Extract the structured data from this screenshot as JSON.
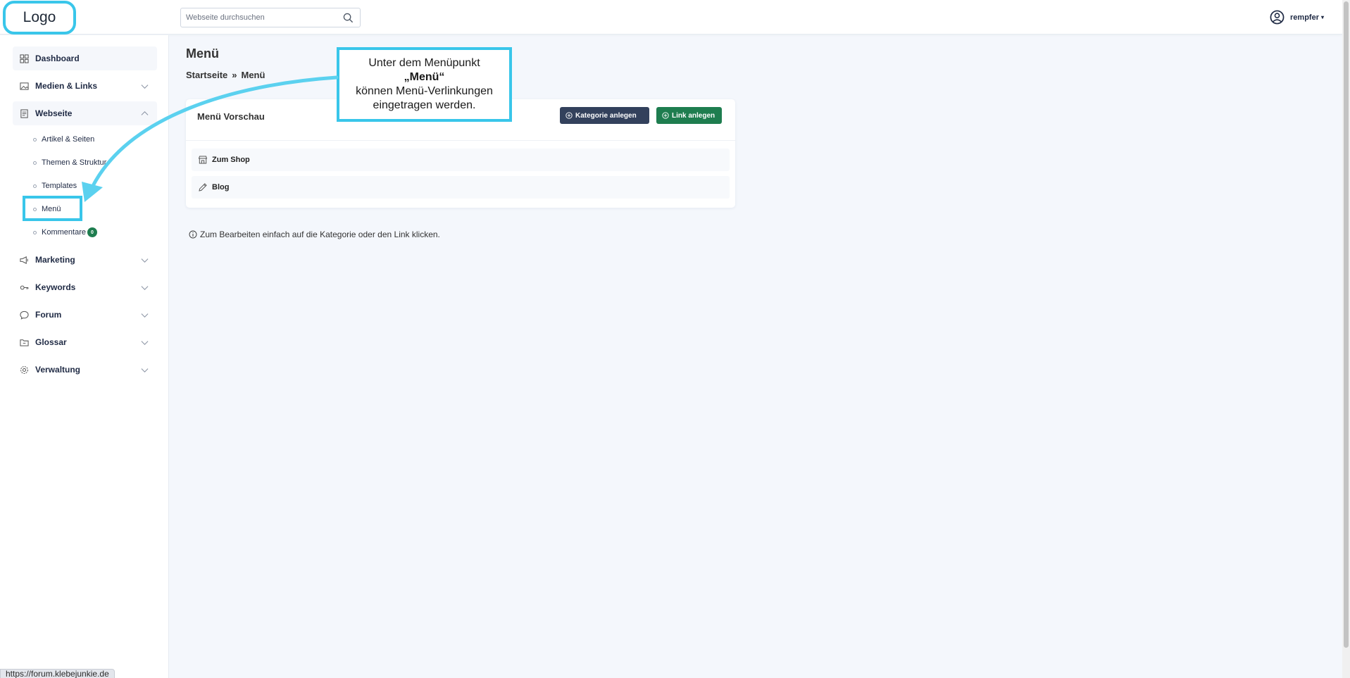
{
  "header": {
    "logo_text": "Logo",
    "search_placeholder": "Webseite durchsuchen",
    "user_name": "rempfer",
    "user_caret": "▾"
  },
  "sidebar": {
    "items": [
      {
        "label": "Dashboard",
        "icon": "grid-icon"
      },
      {
        "label": "Medien & Links",
        "icon": "image-icon"
      },
      {
        "label": "Webseite",
        "icon": "document-icon"
      },
      {
        "label": "Marketing",
        "icon": "megaphone-icon"
      },
      {
        "label": "Keywords",
        "icon": "key-icon"
      },
      {
        "label": "Forum",
        "icon": "chat-icon"
      },
      {
        "label": "Glossar",
        "icon": "folder-icon"
      },
      {
        "label": "Verwaltung",
        "icon": "gear-icon"
      }
    ],
    "subitems": [
      {
        "label": "Artikel & Seiten"
      },
      {
        "label": "Themen & Struktur"
      },
      {
        "label": "Templates"
      },
      {
        "label": "Menü"
      },
      {
        "label": "Kommentare",
        "badge": "0"
      }
    ]
  },
  "main": {
    "title": "Menü",
    "breadcrumb": [
      "Startseite",
      "»",
      "Menü"
    ],
    "card": {
      "title": "Menü Vorschau",
      "btn_category": "Kategorie anlegen",
      "btn_link": "Link anlegen",
      "rows": [
        {
          "label": "Zum Shop",
          "icon": "shop-icon"
        },
        {
          "label": "Blog",
          "icon": "pencil-icon"
        }
      ]
    },
    "hint": "Zum Bearbeiten einfach auf die Kategorie oder den Link klicken."
  },
  "callout": {
    "line1": "Unter dem Menüpunkt",
    "line2": "„Menü“",
    "line3": "können Menü-Verlinkungen",
    "line4": "eingetragen werden."
  },
  "statusbar": {
    "url": "https://forum.klebejunkie.de"
  },
  "colors": {
    "highlight": "#39c6ea",
    "primary_dark": "#33415c",
    "success_green": "#1e7d4f"
  }
}
